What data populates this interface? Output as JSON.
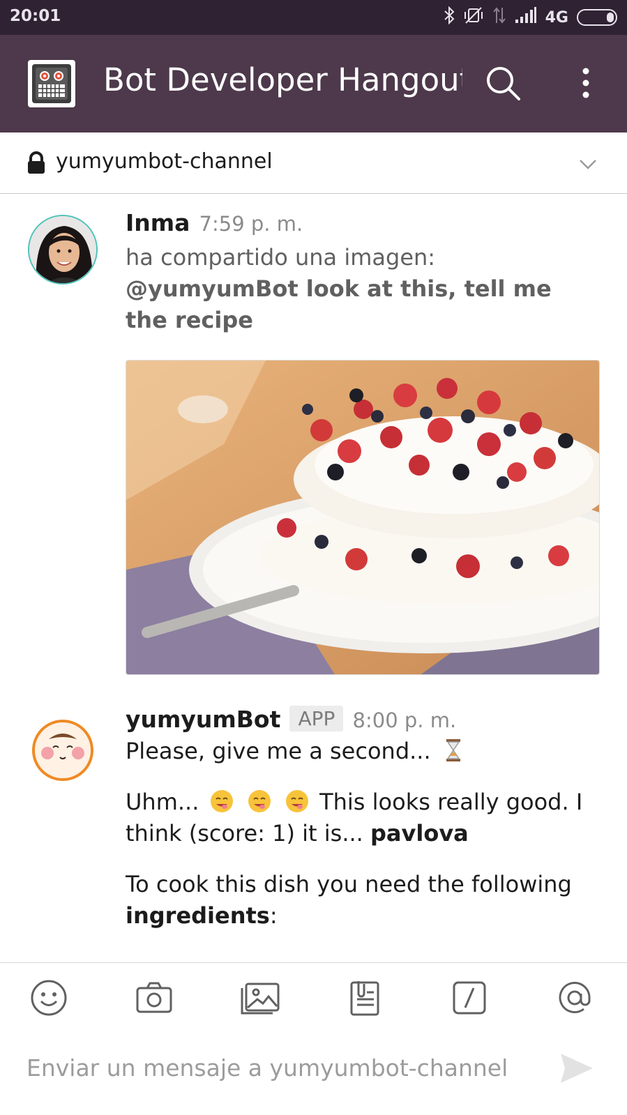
{
  "status_bar": {
    "time": "20:01",
    "network": "4G"
  },
  "header": {
    "team_name": "Bot Developer Hangout",
    "team_icon": "robot-icon"
  },
  "channel": {
    "name": "yumyumbot-channel",
    "lock_icon": "lock-icon"
  },
  "messages": [
    {
      "author": "Inma",
      "time": "7:59 p. m.",
      "share_text": "ha compartido una imagen:",
      "caption": "@yumyumBot look at this, tell me the recipe"
    },
    {
      "author": "yumyumBot",
      "badge": "APP",
      "time": "8:00 p. m.",
      "line1": "Please, give me a second...",
      "line2_start": "Uhm...",
      "line2_after_emoji": "This looks really good. I think (score: 1) it is...",
      "dish": "pavlova",
      "line3_start": "To cook this dish you need the following",
      "ingredients_word": "ingredients",
      "line3_end": ":"
    }
  ],
  "composer": {
    "placeholder": "Enviar un mensaje a yumyumbot-channel"
  },
  "colors": {
    "statusbar_bg": "#2e2233",
    "header_bg": "#4d394b",
    "avatar_ring": "#4ec2b8",
    "bot_ring": "#f08a24"
  }
}
